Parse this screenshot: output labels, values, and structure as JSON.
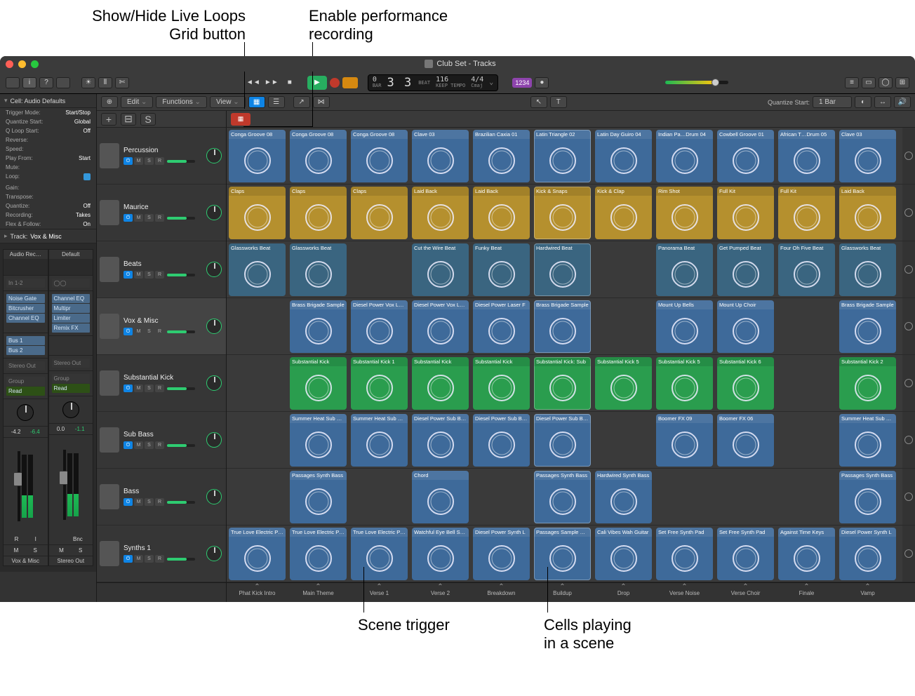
{
  "annotations": {
    "grid_button": "Show/Hide Live Loops\nGrid button",
    "perf_rec": "Enable performance\nrecording",
    "scene_trigger": "Scene trigger",
    "cells_playing": "Cells playing\nin a scene"
  },
  "window": {
    "title": "Club Set - Tracks"
  },
  "toolbar": {
    "lcd": {
      "bar": "3",
      "beat": "3",
      "bar_label": "BAR",
      "beat_label": "BEAT",
      "tempo": "116",
      "tempo_label": "KEEP TEMPO",
      "sig": "4/4",
      "key": "Cmaj"
    },
    "marker": "1234"
  },
  "inspector": {
    "title": "Cell: Audio Defaults",
    "rows": [
      {
        "k": "Trigger Mode:",
        "v": "Start/Stop"
      },
      {
        "k": "Quantize Start:",
        "v": "Global"
      },
      {
        "k": "Q Loop Start:",
        "v": "Off"
      },
      {
        "k": "Reverse:",
        "v": ""
      },
      {
        "k": "Speed:",
        "v": ""
      },
      {
        "k": "Play From:",
        "v": "Start"
      },
      {
        "k": "Mute:",
        "v": ""
      },
      {
        "k": "Loop:",
        "v": "✓"
      },
      {
        "k": "Gain:",
        "v": ""
      },
      {
        "k": "Transpose:",
        "v": ""
      },
      {
        "k": "Quantize:",
        "v": "Off"
      },
      {
        "k": "Recording:",
        "v": "Takes"
      },
      {
        "k": "Flex & Follow:",
        "v": "On"
      }
    ],
    "track_section": {
      "label": "Track:",
      "value": "Vox & Misc"
    }
  },
  "strips": [
    {
      "name": "Vox & Misc",
      "setting": "Audio Rec…",
      "in": "In 1-2",
      "inserts": [
        "Noise Gate",
        "Bitcrusher",
        "Channel EQ"
      ],
      "sends": [
        "Bus 1",
        "Bus 2"
      ],
      "out": "Stereo Out",
      "grp": "Group",
      "auto": "Read",
      "db": [
        "-4.2",
        "-6.4"
      ],
      "rec": "R",
      "in2": "I",
      "bot": [
        "M",
        "S"
      ]
    },
    {
      "name": "Stereo Out",
      "setting": "Default",
      "in": "",
      "inserts": [
        "Channel EQ",
        "Multipr",
        "Limiter",
        "Remix FX"
      ],
      "sends": [],
      "out": "Stereo Out",
      "grp": "Group",
      "auto": "Read",
      "db": [
        "0.0",
        "-1.1"
      ],
      "rec": "",
      "in2": "Bnc",
      "bot": [
        "M",
        "S"
      ]
    }
  ],
  "center_toolbar": {
    "edit": "Edit",
    "functions": "Functions",
    "view": "View",
    "quantize_label": "Quantize Start:",
    "quantize_value": "1 Bar"
  },
  "sub_toolbar": {
    "add": "+",
    "solo": "S"
  },
  "tracks": [
    {
      "name": "Percussion",
      "sel": false
    },
    {
      "name": "Maurice",
      "sel": false
    },
    {
      "name": "Beats",
      "sel": false
    },
    {
      "name": "Vox & Misc",
      "sel": true
    },
    {
      "name": "Substantial Kick",
      "sel": false
    },
    {
      "name": "Sub Bass",
      "sel": false
    },
    {
      "name": "Bass",
      "sel": false
    },
    {
      "name": "Synths 1",
      "sel": false
    }
  ],
  "track_btns": {
    "p": "",
    "m": "M",
    "s": "S",
    "r": "R"
  },
  "scenes": [
    "Phat Kick Intro",
    "Main Theme",
    "Verse 1",
    "Verse 2",
    "Breakdown",
    "Buildup",
    "Drop",
    "Verse Noise",
    "Verse Choir",
    "Finale",
    "Vamp"
  ],
  "cells": [
    [
      {
        "n": "Conga Groove 08",
        "c": "blue"
      },
      {
        "n": "Conga Groove 08",
        "c": "blue"
      },
      {
        "n": "Conga Groove 08",
        "c": "blue"
      },
      {
        "n": "Clave 03",
        "c": "blue"
      },
      {
        "n": "Brazilian Caxia 01",
        "c": "blue"
      },
      {
        "n": "Latin Triangle 02",
        "c": "blue",
        "p": true
      },
      {
        "n": "Latin Day Guiro 04",
        "c": "blue"
      },
      {
        "n": "Indian Pa…Drum 04",
        "c": "blue"
      },
      {
        "n": "Cowbell Groove 01",
        "c": "blue"
      },
      {
        "n": "African T…Drum 05",
        "c": "blue"
      },
      {
        "n": "Clave 03",
        "c": "blue"
      }
    ],
    [
      {
        "n": "Claps",
        "c": "gold"
      },
      {
        "n": "Claps",
        "c": "gold"
      },
      {
        "n": "Claps",
        "c": "gold"
      },
      {
        "n": "Laid Back",
        "c": "gold"
      },
      {
        "n": "Laid Back",
        "c": "gold"
      },
      {
        "n": "Kick & Snaps",
        "c": "gold",
        "p": true
      },
      {
        "n": "Kick & Clap",
        "c": "gold"
      },
      {
        "n": "Rim Shot",
        "c": "gold"
      },
      {
        "n": "Full Kit",
        "c": "gold"
      },
      {
        "n": "Full Kit",
        "c": "gold"
      },
      {
        "n": "Laid Back",
        "c": "gold"
      }
    ],
    [
      {
        "n": "Glassworks Beat",
        "c": "teal"
      },
      {
        "n": "Glassworks Beat",
        "c": "teal"
      },
      null,
      {
        "n": "Cut the Wire Beat",
        "c": "teal"
      },
      {
        "n": "Funky Beat",
        "c": "teal"
      },
      {
        "n": "Hardwired Beat",
        "c": "teal",
        "p": true
      },
      null,
      {
        "n": "Panorama Beat",
        "c": "teal"
      },
      {
        "n": "Get Pumped Beat",
        "c": "teal"
      },
      {
        "n": "Four Oh Five Beat",
        "c": "teal"
      },
      {
        "n": "Glassworks Beat",
        "c": "teal"
      }
    ],
    [
      null,
      {
        "n": "Brass Brigade Sample",
        "c": "blue"
      },
      {
        "n": "Diesel Power Vox Lead",
        "c": "blue"
      },
      {
        "n": "Diesel Power Vox Lead",
        "c": "blue"
      },
      {
        "n": "Diesel Power Laser F",
        "c": "blue"
      },
      {
        "n": "Brass Brigade Sample",
        "c": "blue",
        "p": true
      },
      null,
      {
        "n": "Mount Up Bells",
        "c": "blue"
      },
      {
        "n": "Mount Up Choir",
        "c": "blue"
      },
      null,
      {
        "n": "Brass Brigade Sample",
        "c": "blue"
      }
    ],
    [
      null,
      {
        "n": "Substantial Kick",
        "c": "green"
      },
      {
        "n": "Substantial Kick 1",
        "c": "green"
      },
      {
        "n": "Substantial Kick",
        "c": "green"
      },
      {
        "n": "Substantial Kick",
        "c": "green"
      },
      {
        "n": "Substantial Kick: Sub",
        "c": "green",
        "p": true
      },
      {
        "n": "Substantial Kick 5",
        "c": "green"
      },
      {
        "n": "Substantial Kick 5",
        "c": "green"
      },
      {
        "n": "Substantial Kick 6",
        "c": "green"
      },
      null,
      {
        "n": "Substantial Kick 2",
        "c": "green"
      }
    ],
    [
      null,
      {
        "n": "Summer Heat Sub Bass",
        "c": "blue"
      },
      {
        "n": "Summer Heat Sub Bass",
        "c": "blue"
      },
      {
        "n": "Diesel Power Sub Bass",
        "c": "blue"
      },
      {
        "n": "Diesel Power Sub Bass",
        "c": "blue"
      },
      {
        "n": "Diesel Power Sub Bass",
        "c": "blue",
        "p": true
      },
      null,
      {
        "n": "Boomer FX 09",
        "c": "blue"
      },
      {
        "n": "Boomer FX 06",
        "c": "blue"
      },
      null,
      {
        "n": "Summer Heat Sub Bass",
        "c": "blue"
      }
    ],
    [
      null,
      {
        "n": "Passages Synth Bass",
        "c": "blue"
      },
      null,
      {
        "n": "Chord",
        "c": "blue"
      },
      null,
      {
        "n": "Passages Synth Bass",
        "c": "blue",
        "p": true
      },
      {
        "n": "Hardwired Synth Bass",
        "c": "blue"
      },
      null,
      null,
      null,
      {
        "n": "Passages Synth Bass",
        "c": "blue"
      }
    ],
    [
      {
        "n": "True Love Electric Piano",
        "c": "blue"
      },
      {
        "n": "True Love Electric Piano",
        "c": "blue"
      },
      {
        "n": "True Love Electric Piano",
        "c": "blue"
      },
      {
        "n": "Watchful Eye Bell Synth",
        "c": "blue"
      },
      {
        "n": "Diesel Power Synth L",
        "c": "blue"
      },
      {
        "n": "Passages Sample Stab",
        "c": "blue",
        "p": true
      },
      {
        "n": "Cali Vibes Wah Guitar",
        "c": "blue"
      },
      {
        "n": "Set Free Synth Pad",
        "c": "blue"
      },
      {
        "n": "Set Free Synth Pad",
        "c": "blue"
      },
      {
        "n": "Against Time Keys",
        "c": "blue"
      },
      {
        "n": "Diesel Power Synth L",
        "c": "blue"
      }
    ]
  ]
}
